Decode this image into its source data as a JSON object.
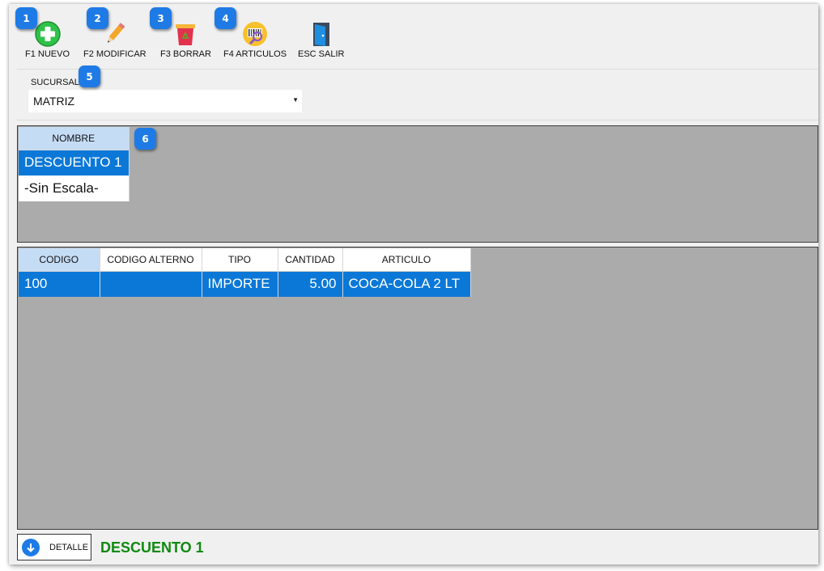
{
  "toolbar": {
    "items": [
      {
        "label": "F1 NUEVO",
        "icon": "add-icon"
      },
      {
        "label": "F2 MODIFICAR",
        "icon": "pencil-icon"
      },
      {
        "label": "F3 BORRAR",
        "icon": "trash-icon"
      },
      {
        "label": "F4 ARTICULOS",
        "icon": "barcode-search-icon"
      },
      {
        "label": "ESC SALIR",
        "icon": "exit-door-icon"
      }
    ]
  },
  "badges": [
    "1",
    "2",
    "3",
    "4",
    "5",
    "6"
  ],
  "sucursal": {
    "label": "SUCURSAL",
    "value": "MATRIZ"
  },
  "grid1": {
    "headers": [
      "NOMBRE"
    ],
    "rows": [
      {
        "nombre": "DESCUENTO 1",
        "selected": true
      },
      {
        "nombre": "-Sin Escala-",
        "selected": false
      }
    ]
  },
  "grid2": {
    "headers": [
      "CODIGO",
      "CODIGO ALTERNO",
      "TIPO",
      "CANTIDAD",
      "ARTICULO"
    ],
    "rows": [
      {
        "codigo": "100",
        "codigo_alterno": "",
        "tipo": "IMPORTE",
        "cantidad": "5.00",
        "articulo": "COCA-COLA 2 LT"
      }
    ]
  },
  "footer": {
    "detalle_label": "DETALLE",
    "status": "DESCUENTO 1"
  },
  "colors": {
    "accent": "#1e7be6",
    "selection": "#0b78d8",
    "status_text": "#0f8a0f",
    "grid_bg": "#ababab"
  }
}
